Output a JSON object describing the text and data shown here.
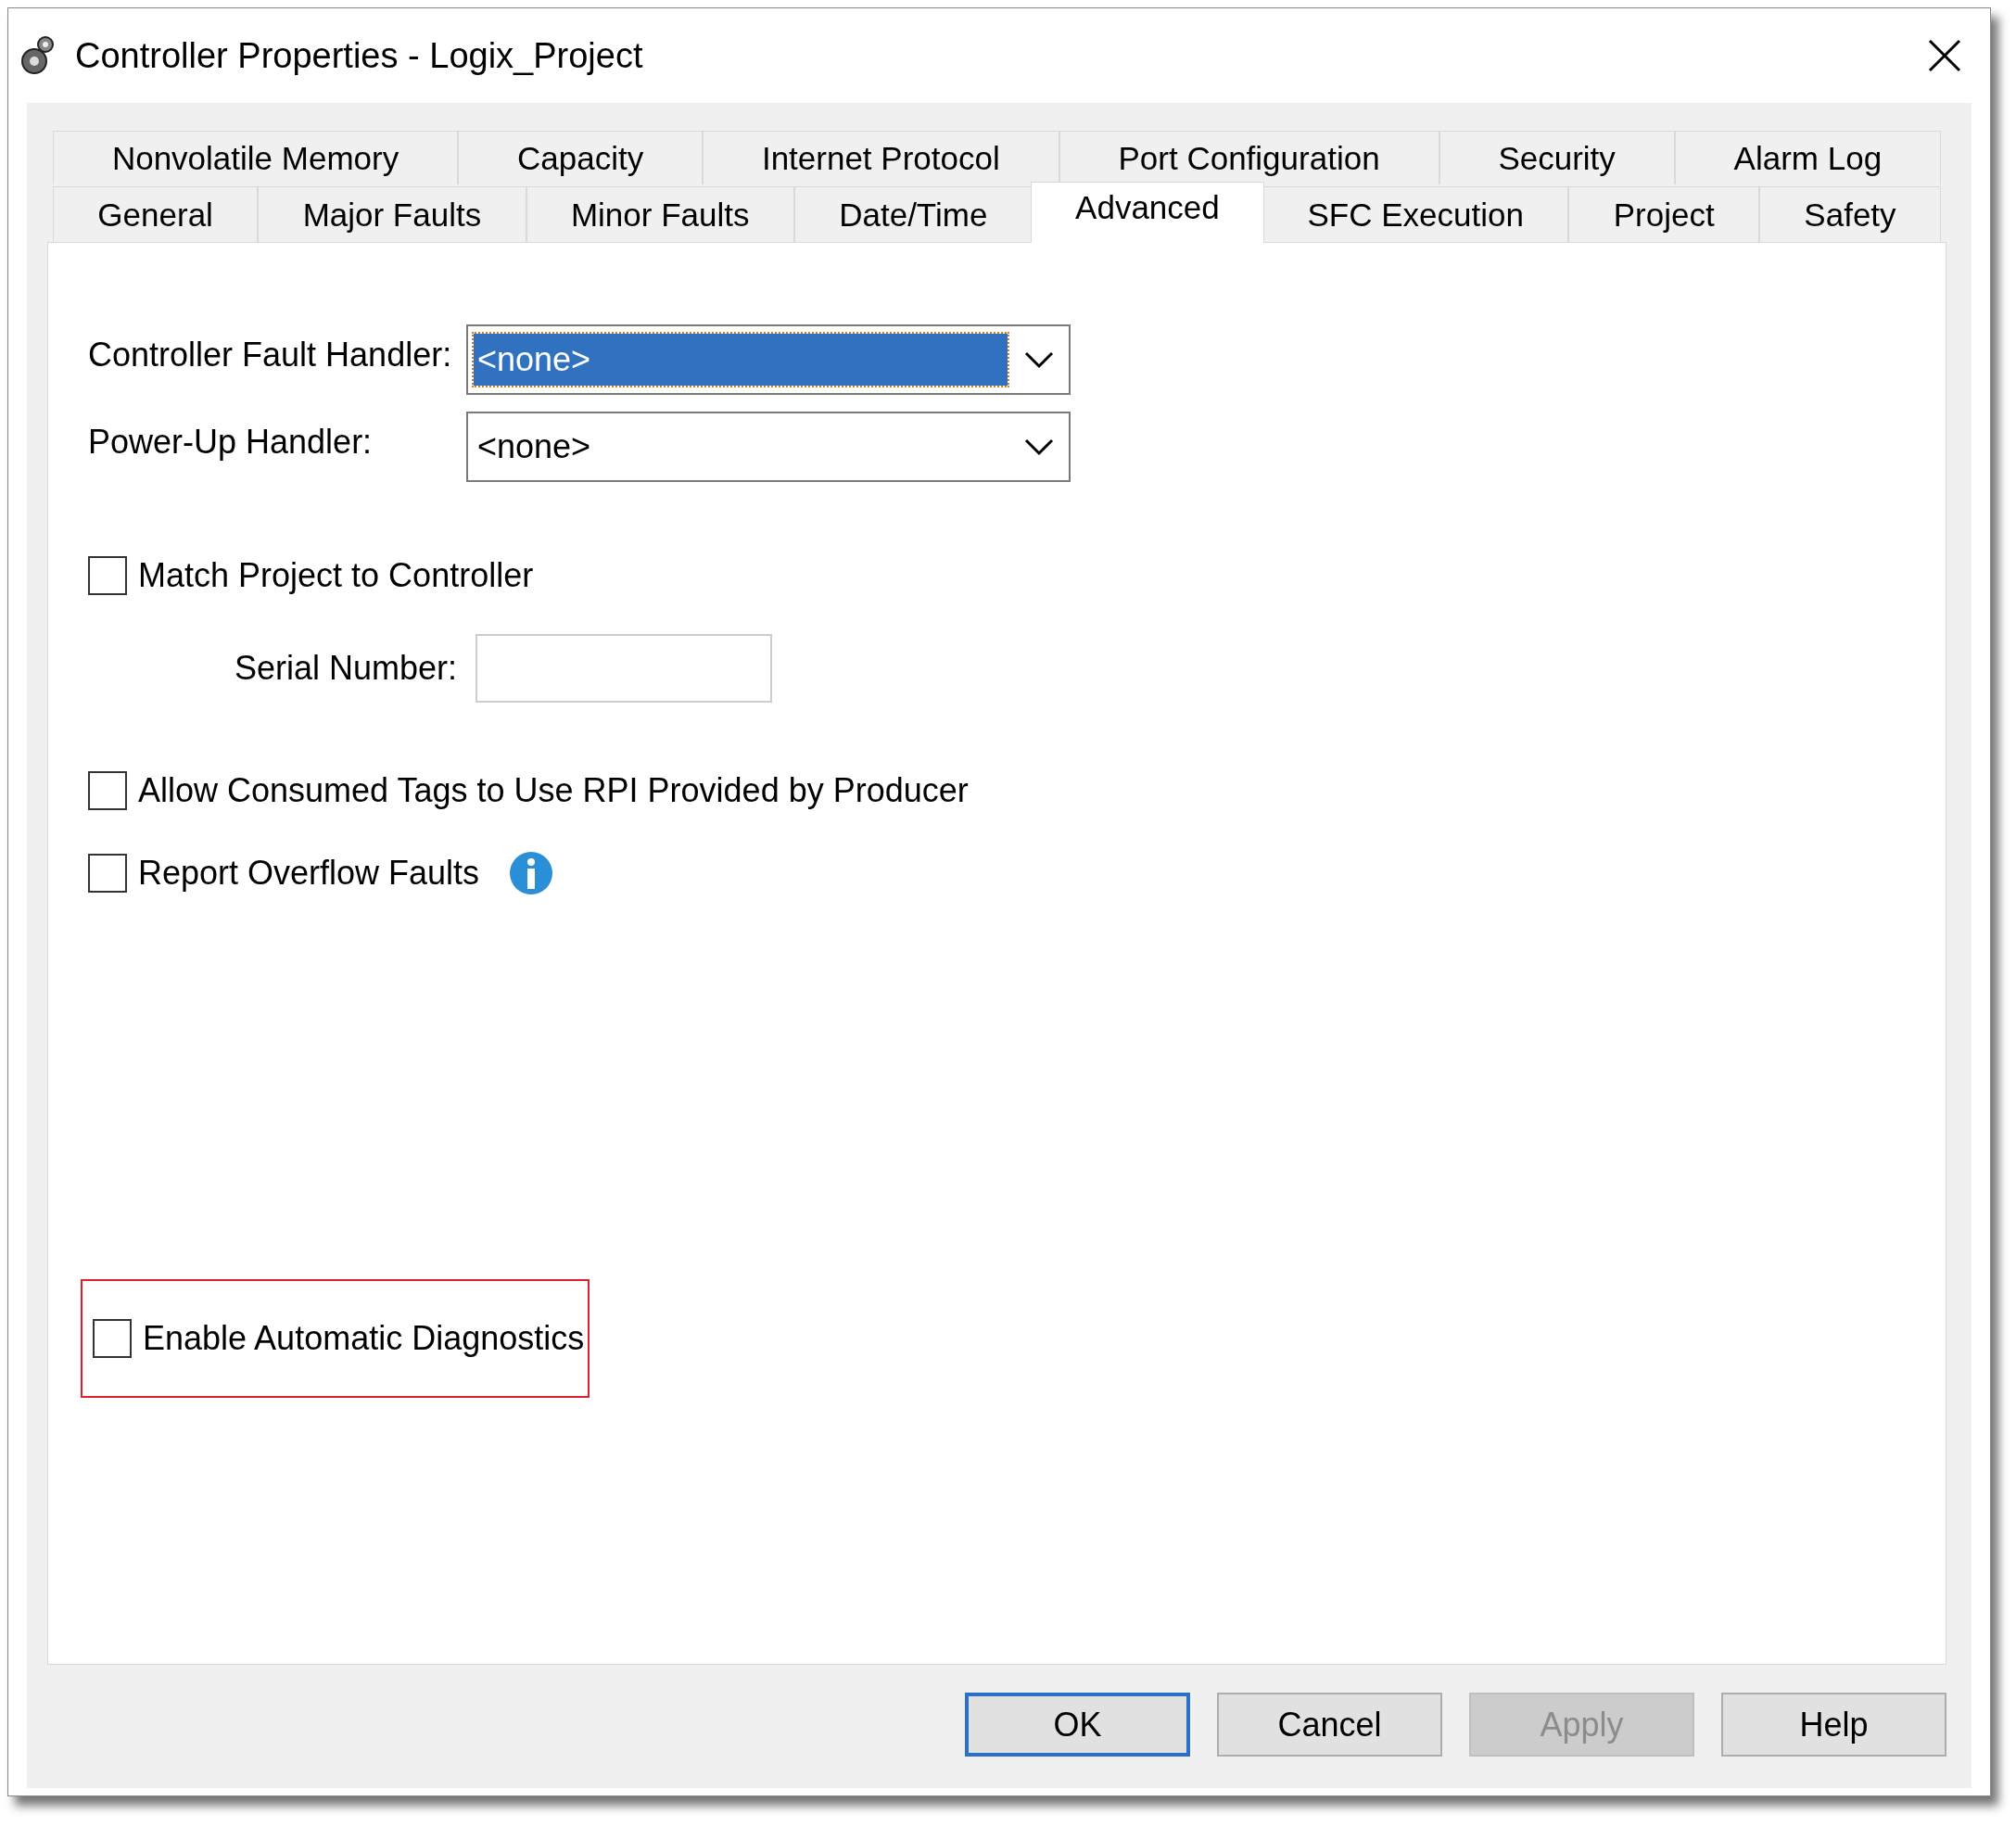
{
  "window": {
    "title": "Controller Properties - Logix_Project"
  },
  "tab_rows": [
    {
      "tabs": [
        {
          "label": "Nonvolatile Memory",
          "selected": false
        },
        {
          "label": "Capacity",
          "selected": false
        },
        {
          "label": "Internet Protocol",
          "selected": false
        },
        {
          "label": "Port Configuration",
          "selected": false
        },
        {
          "label": "Security",
          "selected": false
        },
        {
          "label": "Alarm Log",
          "selected": false
        }
      ]
    },
    {
      "tabs": [
        {
          "label": "General",
          "selected": false
        },
        {
          "label": "Major Faults",
          "selected": false
        },
        {
          "label": "Minor Faults",
          "selected": false
        },
        {
          "label": "Date/Time",
          "selected": false
        },
        {
          "label": "Advanced",
          "selected": true
        },
        {
          "label": "SFC Execution",
          "selected": false
        },
        {
          "label": "Project",
          "selected": false
        },
        {
          "label": "Safety",
          "selected": false
        }
      ]
    }
  ],
  "handlers": [
    {
      "label": "Controller Fault Handler:",
      "value": "<none>",
      "focused": true
    },
    {
      "label": "Power-Up Handler:",
      "value": "<none>",
      "focused": false
    }
  ],
  "match_project": {
    "label": "Match Project to Controller",
    "checked": false,
    "serial_label": "Serial Number:"
  },
  "options": [
    {
      "label": "Allow Consumed Tags to Use RPI Provided by Producer",
      "checked": false,
      "info": false
    },
    {
      "label": "Report Overflow Faults",
      "checked": false,
      "info": true
    }
  ],
  "diagnostics": {
    "label": "Enable Automatic Diagnostics",
    "checked": false,
    "highlighted": true
  },
  "buttons": [
    {
      "label": "OK",
      "default": true,
      "disabled": false
    },
    {
      "label": "Cancel",
      "default": false,
      "disabled": false
    },
    {
      "label": "Apply",
      "default": false,
      "disabled": true
    },
    {
      "label": "Help",
      "default": false,
      "disabled": false
    }
  ]
}
